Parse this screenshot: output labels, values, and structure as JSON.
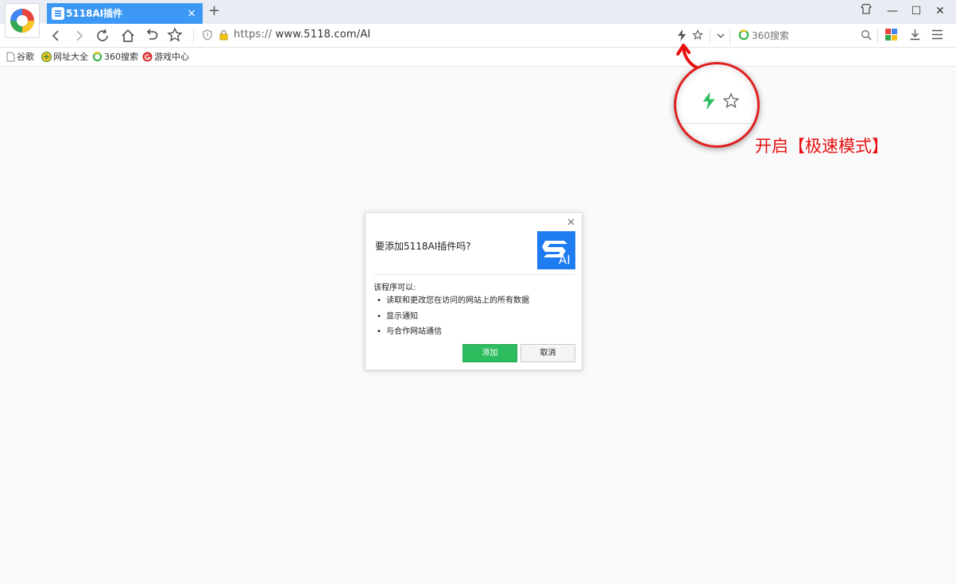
{
  "tab": {
    "title": "5118AI插件",
    "close": "×"
  },
  "newtab_label": "+",
  "window_controls": {
    "skin": "skin-icon",
    "minimize": "—",
    "maximize": "☐",
    "close": "✕"
  },
  "address": {
    "scheme": "https://",
    "host": " www.5118.com/AI"
  },
  "search": {
    "placeholder": "360搜索"
  },
  "bookmarks": [
    "谷歌",
    "网址大全",
    "360搜索",
    "游戏中心"
  ],
  "annotation": {
    "text": "开启【极速模式】"
  },
  "dialog": {
    "title": "要添加5118AI插件吗?",
    "permissions_title": "该程序可以:",
    "permissions": [
      "读取和更改您在访问的网站上的所有数据",
      "显示通知",
      "与合作网站通信"
    ],
    "add_button": "添加",
    "cancel_button": "取消",
    "logo_text": "AI"
  },
  "colors": {
    "tab": "#3d98f5",
    "accent_green": "#2ebd5e",
    "annotation_red": "#e81010",
    "logo_blue": "#1e7bf0"
  }
}
